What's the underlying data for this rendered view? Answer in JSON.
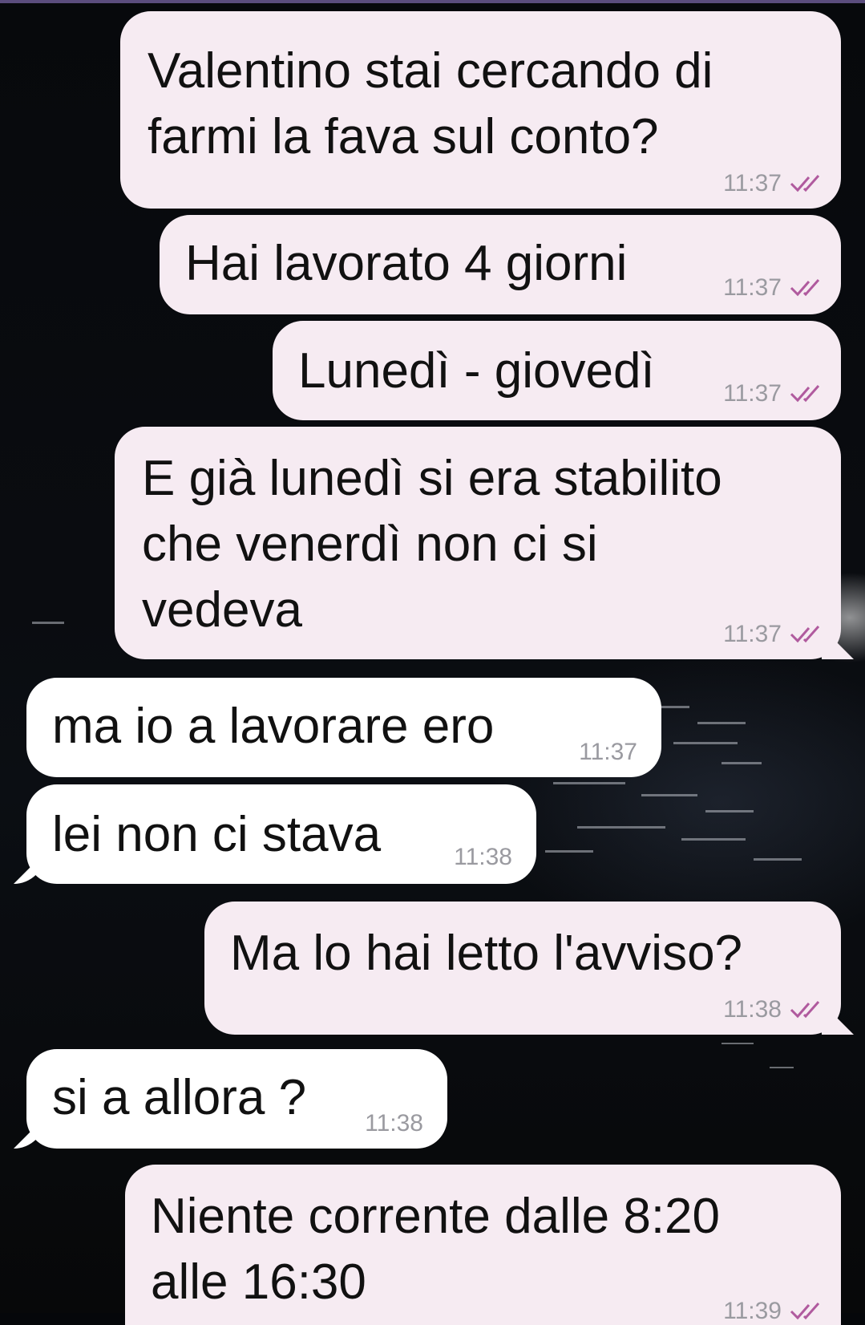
{
  "colors": {
    "outgoing_bubble": "#f6ebf2",
    "incoming_bubble": "#ffffff",
    "read_check": "#b05a9e",
    "time_text": "#9a9aa0"
  },
  "messages": [
    {
      "direction": "outgoing",
      "text": "Valentino stai cercando di\nfarmi la fava sul conto?",
      "time": "11:37",
      "status_icon": "double-check-read-icon"
    },
    {
      "direction": "outgoing",
      "text": "Hai lavorato 4 giorni",
      "time": "11:37",
      "status_icon": "double-check-read-icon"
    },
    {
      "direction": "outgoing",
      "text": "Lunedì - giovedì",
      "time": "11:37",
      "status_icon": "double-check-read-icon"
    },
    {
      "direction": "outgoing",
      "text": "E già lunedì si era stabilito\nche venerdì non ci si\nvedeva",
      "time": "11:37",
      "status_icon": "double-check-read-icon"
    },
    {
      "direction": "incoming",
      "text": "ma io a lavorare ero",
      "time": "11:37"
    },
    {
      "direction": "incoming",
      "text": "lei non ci stava",
      "time": "11:38"
    },
    {
      "direction": "outgoing",
      "text": "Ma lo hai letto l'avviso?",
      "time": "11:38",
      "status_icon": "double-check-read-icon"
    },
    {
      "direction": "incoming",
      "text": "si a allora ?",
      "time": "11:38"
    },
    {
      "direction": "outgoing",
      "text": "Niente corrente dalle 8:20\nalle 16:30",
      "time": "11:39",
      "status_icon": "double-check-read-icon"
    }
  ]
}
